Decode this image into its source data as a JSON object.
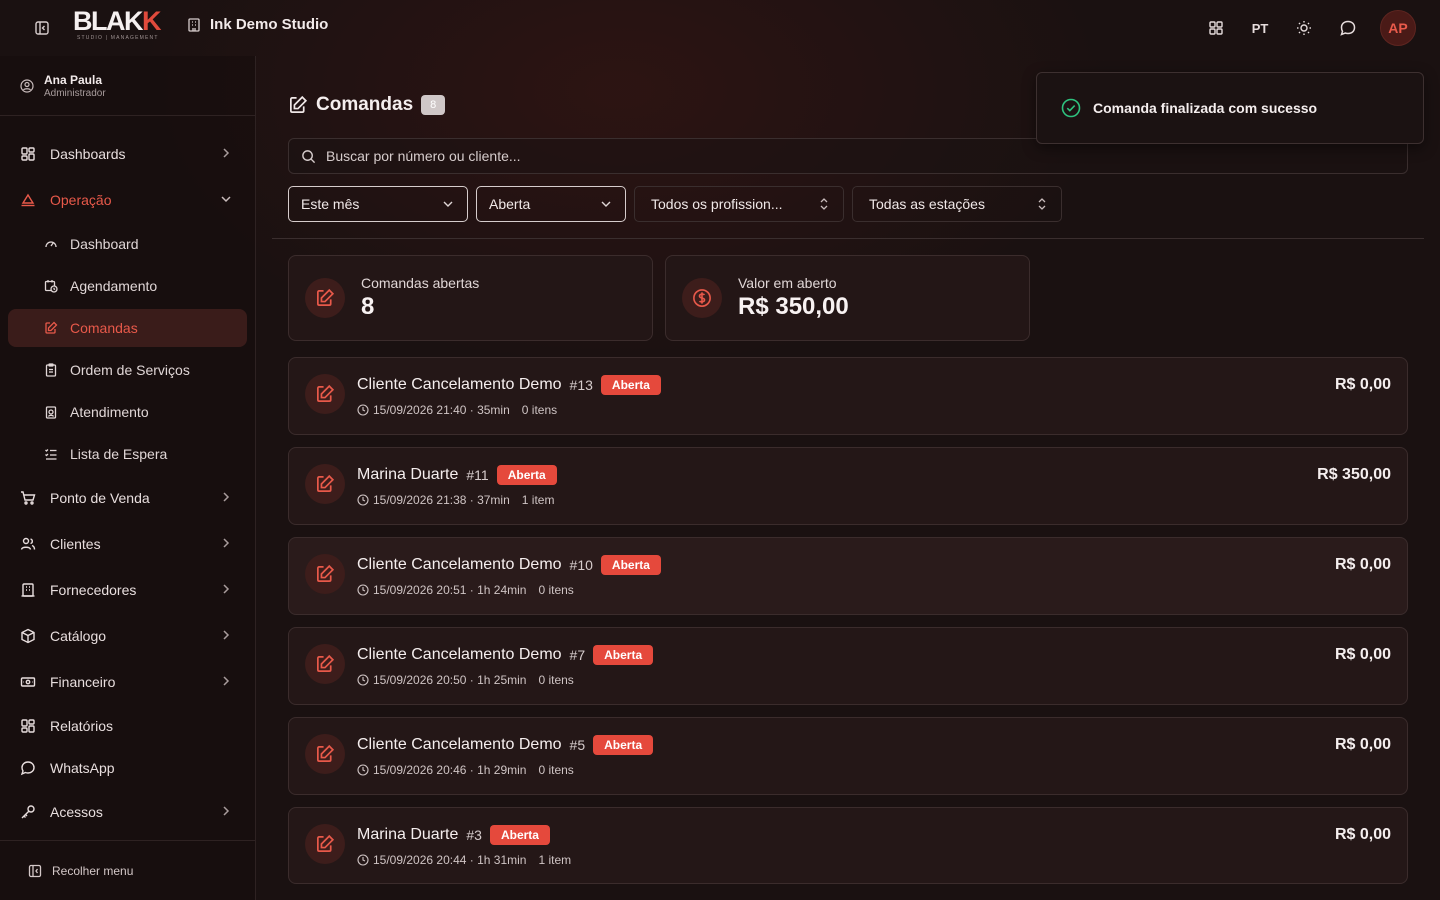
{
  "brand": {
    "logo_main_a": "BLAK",
    "logo_main_b": "K",
    "logo_sub": "STUDIO | MANAGEMENT",
    "studio_name": "Ink Demo Studio"
  },
  "topbar": {
    "language": "PT",
    "avatar_initials": "AP"
  },
  "user": {
    "name": "Ana Paula",
    "role": "Administrador"
  },
  "sidebar": {
    "dashboards": "Dashboards",
    "operacao": "Operação",
    "sub": {
      "dashboard": "Dashboard",
      "agendamento": "Agendamento",
      "comandas": "Comandas",
      "ordem": "Ordem de Serviços",
      "atendimento": "Atendimento",
      "espera": "Lista de Espera"
    },
    "pdv": "Ponto de Venda",
    "clientes": "Clientes",
    "fornecedores": "Fornecedores",
    "catalogo": "Catálogo",
    "financeiro": "Financeiro",
    "relatorios": "Relatórios",
    "whatsapp": "WhatsApp",
    "acessos": "Acessos",
    "collapse": "Recolher menu"
  },
  "page": {
    "title": "Comandas",
    "count": "8",
    "search_placeholder": "Buscar por número ou cliente..."
  },
  "filters": {
    "period": "Este mês",
    "status": "Aberta",
    "professionals": "Todos os profission...",
    "stations": "Todas as estações"
  },
  "stats": {
    "open_label": "Comandas abertas",
    "open_value": "8",
    "amount_label": "Valor em aberto",
    "amount_value": "R$ 350,00"
  },
  "orders": [
    {
      "client": "Cliente Cancelamento Demo",
      "number": "#13",
      "status": "Aberta",
      "time": "15/09/2026 21:40 · 35min",
      "items": "0 itens",
      "price": "R$ 0,00"
    },
    {
      "client": "Marina Duarte",
      "number": "#11",
      "status": "Aberta",
      "time": "15/09/2026 21:38 · 37min",
      "items": "1 item",
      "price": "R$ 350,00"
    },
    {
      "client": "Cliente Cancelamento Demo",
      "number": "#10",
      "status": "Aberta",
      "time": "15/09/2026 20:51 · 1h 24min",
      "items": "0 itens",
      "price": "R$ 0,00"
    },
    {
      "client": "Cliente Cancelamento Demo",
      "number": "#7",
      "status": "Aberta",
      "time": "15/09/2026 20:50 · 1h 25min",
      "items": "0 itens",
      "price": "R$ 0,00"
    },
    {
      "client": "Cliente Cancelamento Demo",
      "number": "#5",
      "status": "Aberta",
      "time": "15/09/2026 20:46 · 1h 29min",
      "items": "0 itens",
      "price": "R$ 0,00"
    },
    {
      "client": "Marina Duarte",
      "number": "#3",
      "status": "Aberta",
      "time": "15/09/2026 20:44 · 1h 31min",
      "items": "1 item",
      "price": "R$ 0,00"
    }
  ],
  "toast": {
    "message": "Comanda finalizada com sucesso"
  },
  "colors": {
    "accent": "#e5493c",
    "background": "#1a1111",
    "success": "#2ec27e"
  }
}
